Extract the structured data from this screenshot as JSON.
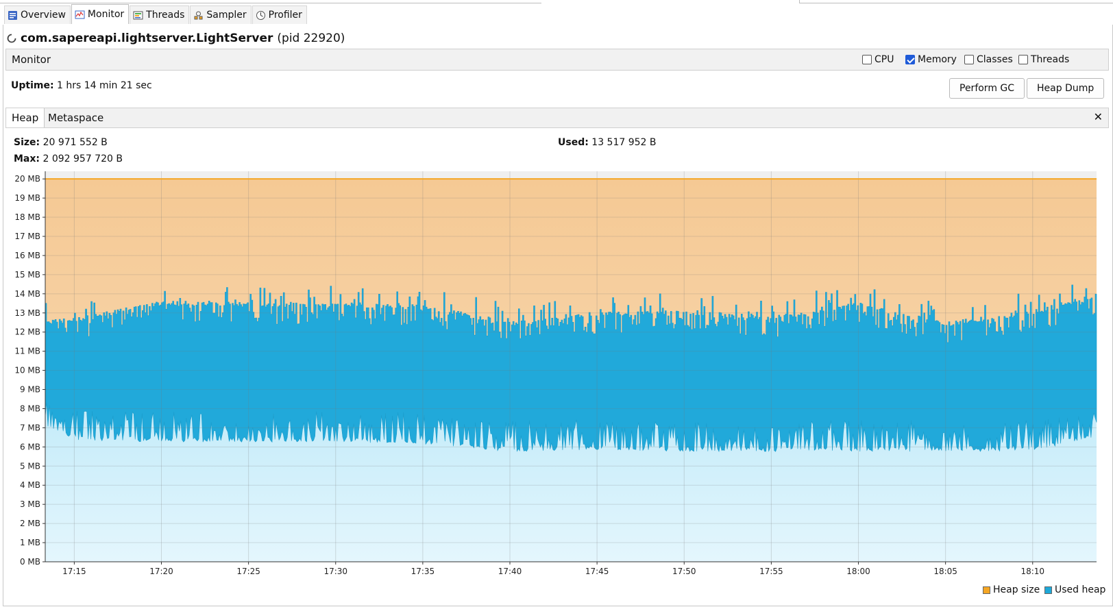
{
  "tabs": [
    {
      "label": "Overview",
      "icon": "overview-icon"
    },
    {
      "label": "Monitor",
      "icon": "monitor-icon"
    },
    {
      "label": "Threads",
      "icon": "threads-icon"
    },
    {
      "label": "Sampler",
      "icon": "sampler-icon"
    },
    {
      "label": "Profiler",
      "icon": "profiler-icon"
    }
  ],
  "active_tab": "Monitor",
  "app": {
    "name": "com.sapereapi.lightserver.LightServer",
    "pid": "(pid 22920)"
  },
  "monitor": {
    "label": "Monitor",
    "checkboxes": [
      {
        "label": "CPU",
        "checked": false
      },
      {
        "label": "Memory",
        "checked": true
      },
      {
        "label": "Classes",
        "checked": false
      },
      {
        "label": "Threads",
        "checked": false
      }
    ]
  },
  "uptime": {
    "label": "Uptime:",
    "value": "1 hrs 14 min 21 sec"
  },
  "buttons": {
    "gc": "Perform GC",
    "dump": "Heap Dump"
  },
  "subtabs": [
    "Heap",
    "Metaspace"
  ],
  "heap": {
    "size_label": "Size:",
    "size_value": "20 971 552 B",
    "used_label": "Used:",
    "used_value": "13 517 952 B",
    "max_label": "Max:",
    "max_value": "2 092 957 720 B"
  },
  "colors": {
    "heap_size": "#f5a623",
    "used_heap": "#1ea8d8"
  },
  "chart_data": {
    "type": "area",
    "ylim": [
      0,
      20.4
    ],
    "y_ticks": [
      "0 MB",
      "1 MB",
      "2 MB",
      "3 MB",
      "4 MB",
      "5 MB",
      "6 MB",
      "7 MB",
      "8 MB",
      "9 MB",
      "10 MB",
      "11 MB",
      "12 MB",
      "13 MB",
      "14 MB",
      "15 MB",
      "16 MB",
      "17 MB",
      "18 MB",
      "19 MB",
      "20 MB"
    ],
    "x_ticks": [
      "17:15",
      "17:20",
      "17:25",
      "17:30",
      "17:35",
      "17:40",
      "17:45",
      "17:50",
      "17:55",
      "18:00",
      "18:05",
      "18:10"
    ],
    "xlim": [
      "17:13:20",
      "18:13:40"
    ],
    "legend": "bottom-right",
    "grid": true,
    "series": [
      {
        "name": "Heap size",
        "color": "#f5a623",
        "values_mb": [
          20,
          20
        ]
      },
      {
        "name": "Used heap",
        "color": "#1ea8d8",
        "x": [
          "17:13:20",
          "17:15",
          "17:20",
          "17:25",
          "17:30",
          "17:35",
          "17:40",
          "17:45",
          "17:50",
          "17:55",
          "18:00",
          "18:05",
          "18:10",
          "18:13:40"
        ],
        "upper_mb": [
          12.4,
          12.5,
          13.4,
          13.3,
          13.3,
          13.2,
          12.3,
          12.8,
          12.9,
          12.6,
          13.3,
          12.3,
          12.9,
          13.8
        ],
        "lower_mb": [
          7.3,
          6.6,
          6.5,
          6.5,
          6.5,
          6.4,
          6.0,
          6.1,
          6.0,
          6.0,
          6.0,
          6.0,
          6.0,
          6.8
        ]
      }
    ]
  }
}
